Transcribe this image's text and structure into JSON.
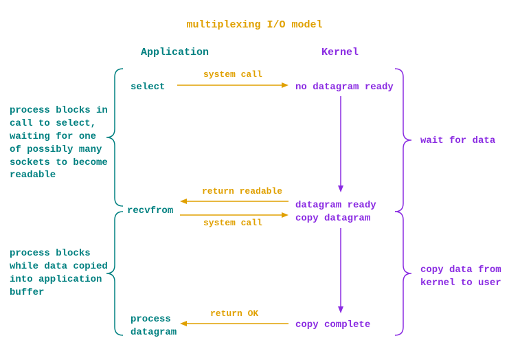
{
  "title": "multiplexing I/O model",
  "headers": {
    "application": "Application",
    "kernel": "Kernel"
  },
  "left_notes": {
    "n1": "process blocks in\ncall to select,\nwaiting for one\nof possibly many\nsockets to become\nreadable",
    "n2": "process blocks\nwhile data copied\ninto application\nbuffer"
  },
  "right_notes": {
    "n1": "wait for data",
    "n2": "copy data from\nkernel to user"
  },
  "app_steps": {
    "select": "select",
    "recvfrom": "recvfrom",
    "process": "process\ndatagram"
  },
  "kernel_steps": {
    "no_dg": "no datagram ready",
    "dg_ready": "datagram ready\ncopy datagram",
    "copy_complete": "copy complete"
  },
  "arrow_labels": {
    "syscall1": "system call",
    "return_readable": "return readable",
    "syscall2": "system call",
    "return_ok": "return OK"
  }
}
